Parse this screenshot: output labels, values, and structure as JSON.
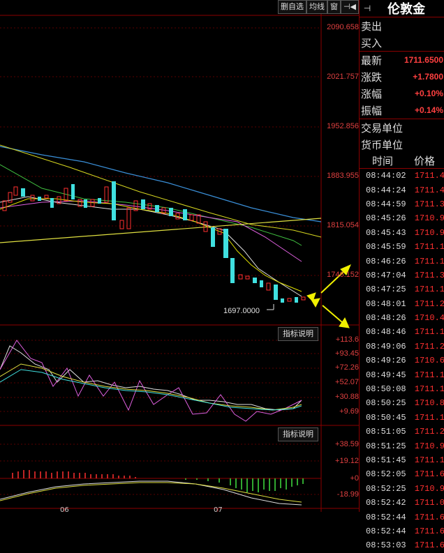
{
  "toolbar": {
    "items": [
      "删自选",
      "均线",
      "窗",
      "⊣◀"
    ]
  },
  "price_axis": [
    "2090.658",
    "2021.757",
    "1952.856",
    "1883.955",
    "1815.054",
    "1746.152"
  ],
  "low_marker": "1697.0000",
  "indicator_buttons": [
    "指标说明",
    "指标说明"
  ],
  "osc1_axis": [
    "+113.6",
    "+93.45",
    "+72.26",
    "+52.07",
    "+30.88",
    "+9.69"
  ],
  "osc2_axis": [
    "+38.59",
    "+19.12",
    "+0",
    "-18.99"
  ],
  "date_ticks": [
    "06",
    "07"
  ],
  "quote": {
    "title": "伦敦金",
    "rows": [
      {
        "label": "卖出",
        "value": ""
      },
      {
        "label": "买入",
        "value": ""
      },
      {
        "label": "最新",
        "value": "1711.6500"
      },
      {
        "label": "涨跌",
        "value": "+1.7800"
      },
      {
        "label": "涨幅",
        "value": "+0.10%"
      },
      {
        "label": "振幅",
        "value": "+0.14%"
      },
      {
        "label": "交易单位",
        "value": ""
      },
      {
        "label": "货币单位",
        "value": ""
      }
    ]
  },
  "ticks_header": {
    "time": "时间",
    "price": "价格"
  },
  "ticks": [
    {
      "time": "08:44:02",
      "price": "1711.4"
    },
    {
      "time": "08:44:24",
      "price": "1711.4"
    },
    {
      "time": "08:44:59",
      "price": "1711.3"
    },
    {
      "time": "08:45:26",
      "price": "1710.9"
    },
    {
      "time": "08:45:43",
      "price": "1710.9"
    },
    {
      "time": "08:45:59",
      "price": "1711.1"
    },
    {
      "time": "08:46:26",
      "price": "1711.1"
    },
    {
      "time": "08:47:04",
      "price": "1711.3"
    },
    {
      "time": "08:47:25",
      "price": "1711.1"
    },
    {
      "time": "08:48:01",
      "price": "1711.2"
    },
    {
      "time": "08:48:26",
      "price": "1710.4"
    },
    {
      "time": "08:48:46",
      "price": "1711.1"
    },
    {
      "time": "08:49:06",
      "price": "1711.2"
    },
    {
      "time": "08:49:26",
      "price": "1710.6"
    },
    {
      "time": "08:49:45",
      "price": "1711.1"
    },
    {
      "time": "08:50:08",
      "price": "1711.1"
    },
    {
      "time": "08:50:25",
      "price": "1710.8"
    },
    {
      "time": "08:50:45",
      "price": "1711.1"
    },
    {
      "time": "08:51:05",
      "price": "1711.2"
    },
    {
      "time": "08:51:25",
      "price": "1710.9"
    },
    {
      "time": "08:51:45",
      "price": "1711.1"
    },
    {
      "time": "08:52:05",
      "price": "1711.6"
    },
    {
      "time": "08:52:25",
      "price": "1710.9"
    },
    {
      "time": "08:52:42",
      "price": "1711.0"
    },
    {
      "time": "08:52:44",
      "price": "1711.6"
    },
    {
      "time": "08:52:44",
      "price": "1711.6"
    },
    {
      "time": "08:53:03",
      "price": "1711.6"
    }
  ],
  "colors": {
    "up": "#ff3030",
    "down": "#40e0e0",
    "grid": "#8b0000",
    "axis_text": "#e04040"
  }
}
